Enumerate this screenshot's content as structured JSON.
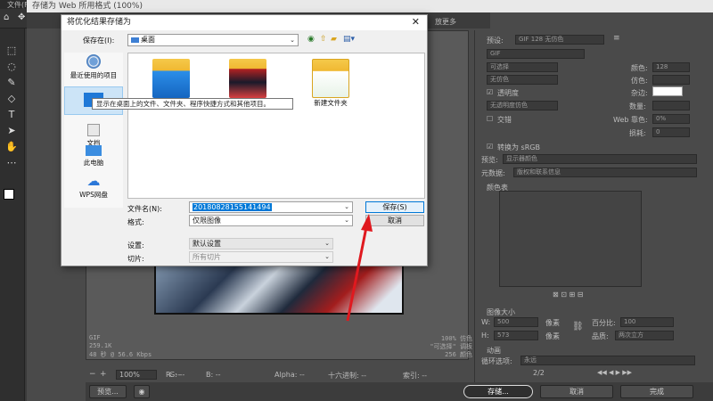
{
  "ps": {
    "menu": [
      "文件(F)",
      "编辑"
    ],
    "sfw_title": "存储为 Web 所用格式 (100%)",
    "tab_more": "放更多"
  },
  "dialog": {
    "title": "将优化结果存储为",
    "close": "✕",
    "savein_label": "保存在(I):",
    "savein_value": "桌面",
    "places": [
      {
        "label": "最近使用的项目"
      },
      {
        "label": "桌面"
      },
      {
        "label": "文档"
      },
      {
        "label": "此电脑"
      },
      {
        "label": "WPS网盘"
      }
    ],
    "files": [
      {
        "label": ""
      },
      {
        "label": ""
      },
      {
        "label": "新建文件夹"
      }
    ],
    "tooltip": "显示在桌面上的文件、文件夹、程序快捷方式和其他项目。",
    "filename_label": "文件名(N):",
    "filename_value": "20180828155141494",
    "format_label": "格式:",
    "format_value": "仅限图像",
    "settings_label": "设置:",
    "settings_value": "默认设置",
    "slices_label": "切片:",
    "slices_value": "所有切片",
    "save_button": "保存(S)",
    "cancel_button": "取消"
  },
  "right_panel": {
    "preset_label": "预设:",
    "preset_value": "GIF 128 无仿色",
    "format_value": "GIF",
    "reduction_value": "可选择",
    "colors_label": "颜色:",
    "colors_value": "128",
    "dither_value": "无仿色",
    "dither_label": "仿色:",
    "transparency_label": "透明度",
    "matte_label": "杂边:",
    "trans_dither_value": "无透明度仿色",
    "amount_label": "数量:",
    "interlace_label": "交错",
    "websnap_label": "Web 靠色:",
    "websnap_value": "0%",
    "lossy_label": "损耗:",
    "lossy_value": "0",
    "convert_label": "转换为 sRGB",
    "preview_label": "预览:",
    "preview_value": "显示器颜色",
    "metadata_label": "元数据:",
    "metadata_value": "版权和联系信息",
    "color_table_label": "颜色表",
    "image_size_label": "图像大小",
    "w_label": "W:",
    "w_value": "500",
    "h_label": "H:",
    "h_value": "573",
    "px": "像素",
    "percent_label": "百分比:",
    "percent_value": "100",
    "quality_label": "品质:",
    "quality_value": "两次立方",
    "animation_label": "动画",
    "loop_label": "循环选项:",
    "loop_value": "永远",
    "frame_counter": "2/2"
  },
  "preview_info": {
    "format": "GIF",
    "size": "259.1K",
    "speed": "48 秒 @ 56.6 Kbps",
    "dither": "100% 仿色",
    "palette": "\"可选择\" 调板",
    "colors": "256 颜色"
  },
  "status": {
    "zoom": "100%",
    "r": "R: --",
    "g": "G: --",
    "b": "B: --",
    "alpha": "Alpha: --",
    "hex": "十六进制: --",
    "index": "索引: --"
  },
  "bottom": {
    "preview_button": "预览...",
    "store_button": "存储...",
    "cancel_button": "取消",
    "done_button": "完成"
  },
  "colors": {
    "accent": "#0078d7",
    "arrow": "#e0191f"
  }
}
